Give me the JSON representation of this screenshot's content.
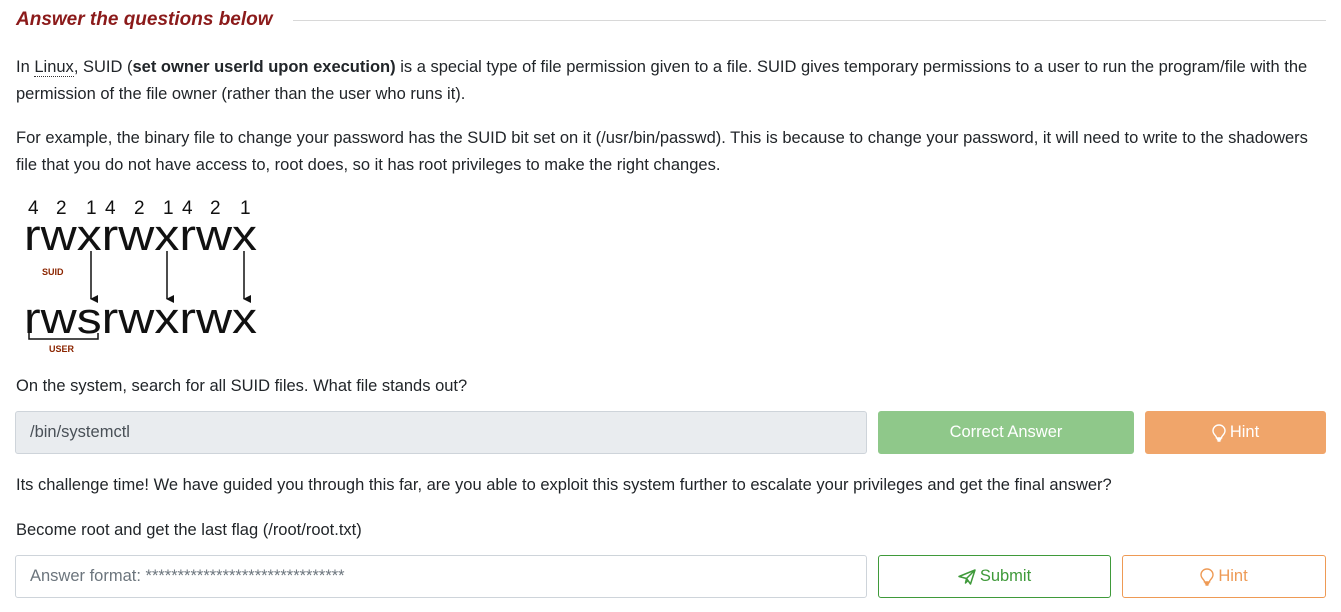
{
  "section_title": "Answer the questions below",
  "intro": {
    "p1_before": "In ",
    "p1_abbr": "Linux",
    "p1_mid": ", SUID (",
    "p1_bold": "set owner userId upon execution)",
    "p1_after": " is a special type of file permission given to a file. SUID gives temporary permissions to a user to run the program/file with the permission of the file owner (rather than the user who runs it).",
    "p2": "For example, the binary file to change your password has the SUID bit set on it (/usr/bin/passwd). This is because to change your password, it will need to write to the shadowers file that you do not have access to, root does, so it has root privileges to make the right changes."
  },
  "diagram": {
    "numbers": [
      "4",
      "2",
      "1",
      "4",
      "2",
      "1",
      "4",
      "2",
      "1"
    ],
    "top_perms": "rwxrwxrwx",
    "bottom_perms": "rwsrwxrwx",
    "suid_label": "SUID",
    "user_label": "USER"
  },
  "question1": {
    "text": "On the system, search for all SUID files. What file stands out?",
    "answer_value": "/bin/systemctl",
    "correct_label": "Correct Answer",
    "hint_label": "Hint",
    "hint_icon": "lightbulb-icon"
  },
  "question2": {
    "intro": "Its challenge time! We have guided you through this far, are you able to exploit this system further to escalate your privileges and get the final answer?",
    "text": "Become root and get the last flag (/root/root.txt)",
    "placeholder": "Answer format: *******************************",
    "submit_label": "Submit",
    "submit_icon": "paper-plane-icon",
    "hint_label": "Hint",
    "hint_icon": "lightbulb-icon"
  },
  "colors": {
    "title": "#8b1a1a",
    "correct": "#8fc88a",
    "hint": "#f0a56a",
    "submit": "#3f9a3a",
    "diagram_label": "#8b2500"
  }
}
